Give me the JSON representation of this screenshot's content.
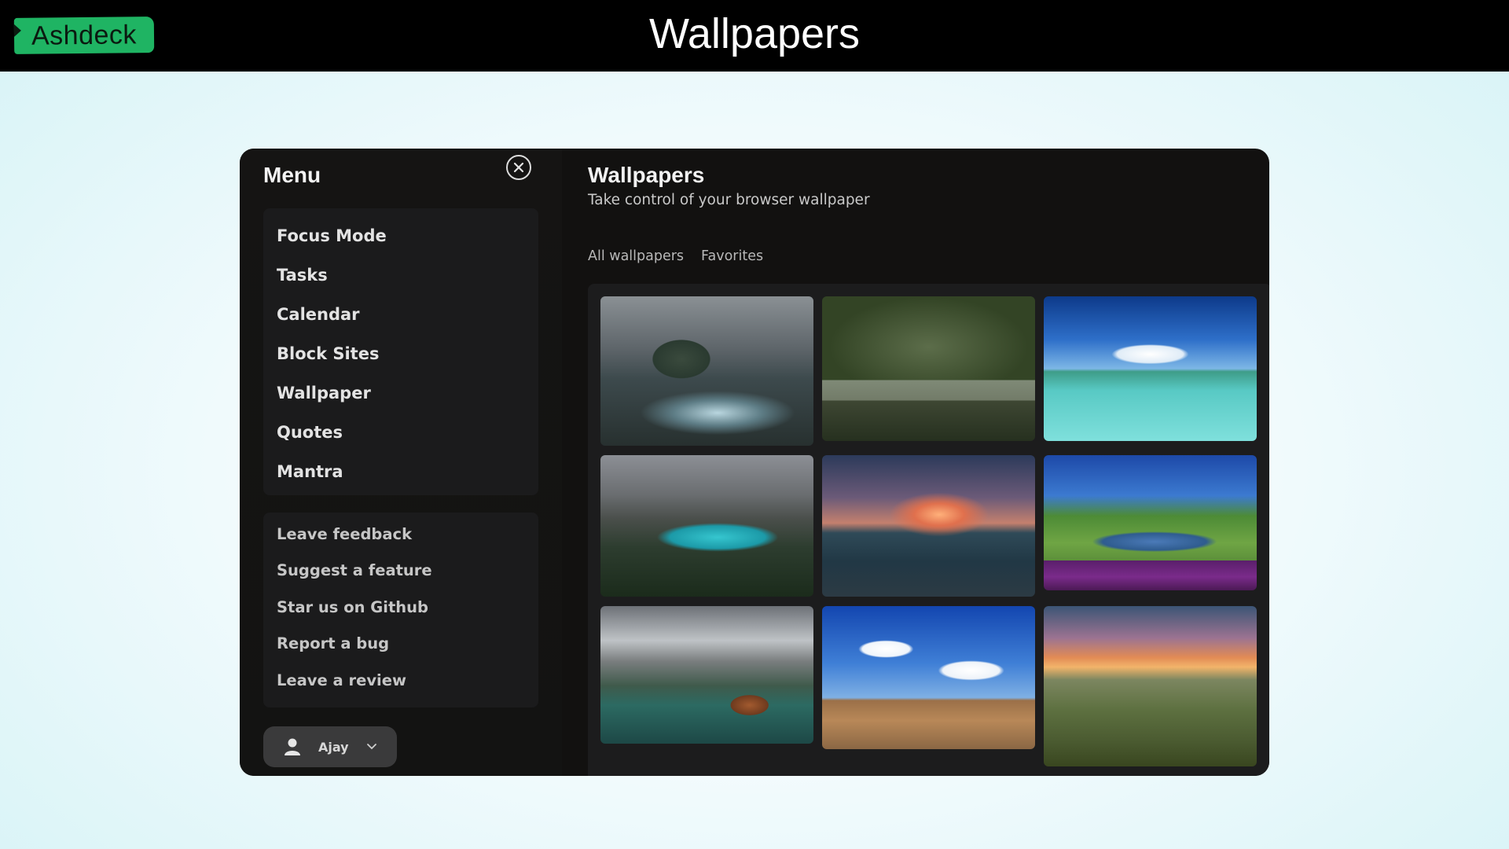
{
  "topbar": {
    "brand": "Ashdeck",
    "page_heading": "Wallpapers"
  },
  "sidebar": {
    "title": "Menu",
    "nav_items": [
      {
        "label": "Focus Mode"
      },
      {
        "label": "Tasks"
      },
      {
        "label": "Calendar"
      },
      {
        "label": "Block Sites"
      },
      {
        "label": "Wallpaper"
      },
      {
        "label": "Quotes"
      },
      {
        "label": "Mantra"
      }
    ],
    "link_items": [
      {
        "label": "Leave feedback"
      },
      {
        "label": "Suggest a feature"
      },
      {
        "label": "Star us on Github"
      },
      {
        "label": "Report a bug"
      },
      {
        "label": "Leave a review"
      }
    ],
    "user": {
      "name": "Ajay"
    }
  },
  "content": {
    "title": "Wallpapers",
    "subtitle": "Take control of your browser wallpaper",
    "tabs": [
      {
        "label": "All wallpapers"
      },
      {
        "label": "Favorites"
      }
    ],
    "wallpapers": [
      "sea-arch-rocks",
      "deer-temple-garden",
      "tropical-beach",
      "mountain-lake-turquoise",
      "sunset-sea",
      "river-flowers-park",
      "mountain-lake-cabin",
      "blue-sky-field",
      "rolling-hills-sunset"
    ]
  },
  "colors": {
    "brand_green": "#1fb463",
    "window_bg": "#121110",
    "card_bg": "#1b1b1c"
  }
}
